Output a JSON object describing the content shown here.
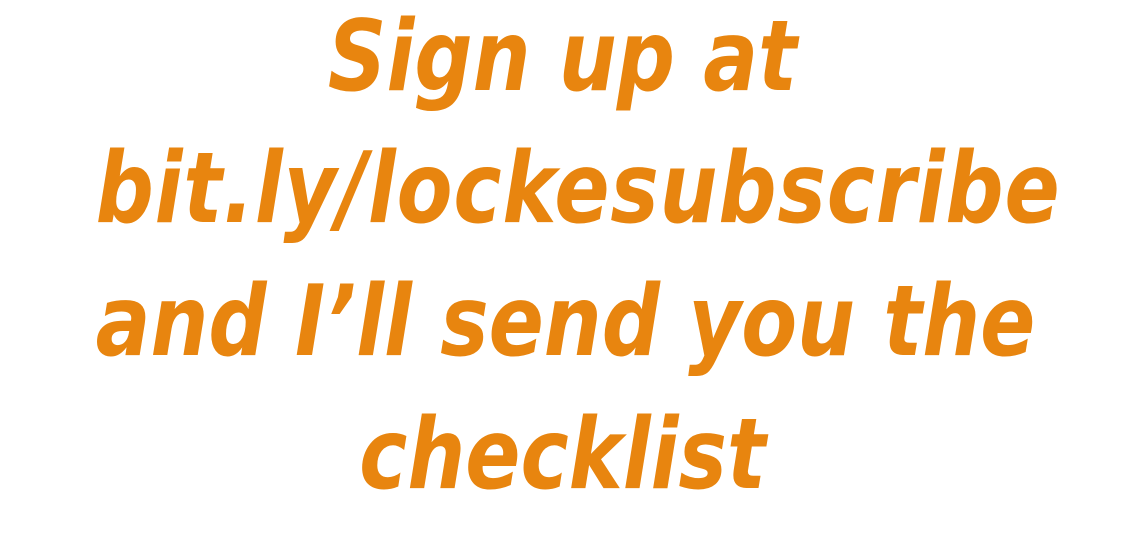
{
  "message": {
    "line1": "Sign up at",
    "line2": "bit.ly/lockesubscribe",
    "line3": "and I’ll send you the",
    "line4": "checklist"
  },
  "colors": {
    "text": "#E8850F",
    "background": "#FFFFFF"
  }
}
